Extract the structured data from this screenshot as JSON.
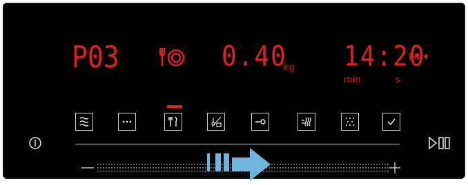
{
  "display": {
    "program": "P03",
    "weight": "0.40",
    "weight_unit": "kg",
    "time": "14:20",
    "time_unit_min": "min",
    "time_unit_s": "s"
  },
  "icons": [
    "rapid-heat-icon",
    "more-options-icon",
    "assist-cooking-icon",
    "meat-probe-weight-icon",
    "child-lock-icon",
    "fast-preheat-icon",
    "cleaning-icon",
    "confirm-icon"
  ],
  "colors": {
    "display_red": "#e0211d",
    "slider_blue": "#6cb6de",
    "background": "#000000"
  },
  "selected_function": "assist-cooking-icon",
  "slider": {
    "min_label": "–",
    "max_label": "+"
  }
}
